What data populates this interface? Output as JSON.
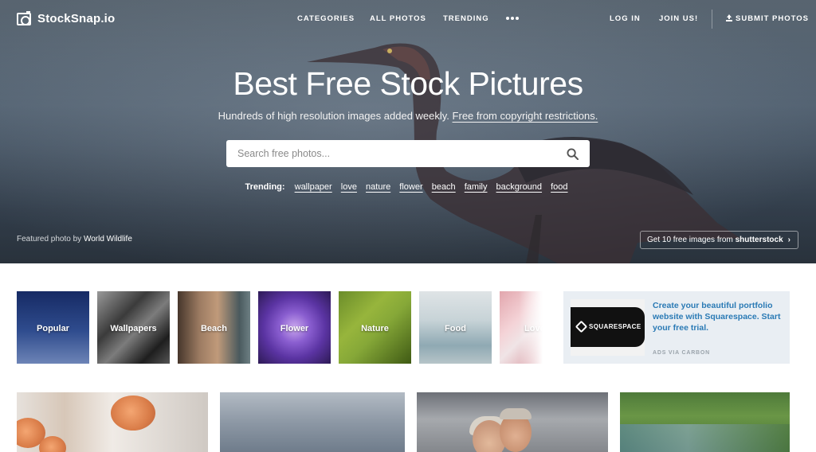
{
  "brand": {
    "name": "StockSnap.io"
  },
  "nav": {
    "categories": "CATEGORIES",
    "all_photos": "ALL PHOTOS",
    "trending": "TRENDING",
    "more_icon": "more-dots-icon",
    "login": "LOG IN",
    "join": "JOIN US!",
    "submit": "SUBMIT PHOTOS"
  },
  "hero": {
    "title": "Best Free Stock Pictures",
    "subtitle": "Hundreds of high resolution images added weekly.",
    "subtitle_link": "Free from copyright restrictions.",
    "search_placeholder": "Search free photos...",
    "trending_label": "Trending:",
    "trending_tags": [
      "wallpaper",
      "love",
      "nature",
      "flower",
      "beach",
      "family",
      "background",
      "food"
    ],
    "featured_prefix": "Featured photo by",
    "featured_author": "World Wildlife",
    "promo_text": "Get 10 free images from",
    "promo_brand": "shutterstock",
    "promo_icon": "chevron-right-icon"
  },
  "categories": [
    "Popular",
    "Wallpapers",
    "Beach",
    "Flower",
    "Nature",
    "Food",
    "Love"
  ],
  "ad": {
    "brand": "SQUARESPACE",
    "text": "Create your beautiful portfolio website with Squarespace. Start your free trial.",
    "via": "ADS VIA CARBON"
  },
  "colors": {
    "ad_link": "#2a7ab5",
    "ad_bg": "#e9eef3"
  }
}
